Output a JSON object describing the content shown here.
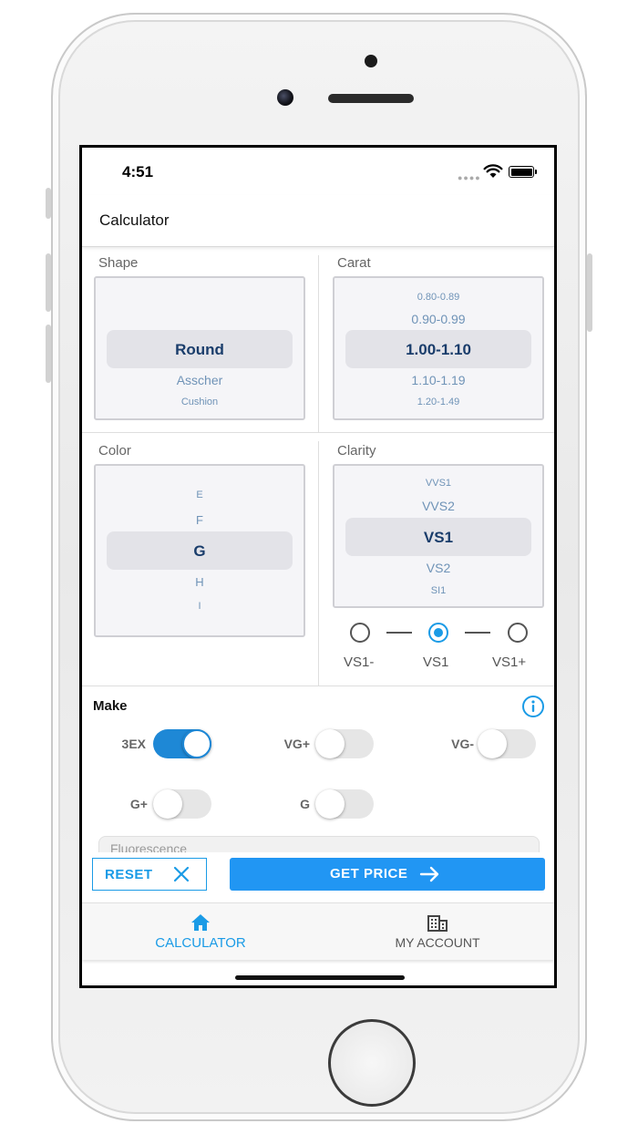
{
  "status_bar": {
    "time": "4:51"
  },
  "header": {
    "title": "Calculator"
  },
  "shape": {
    "label": "Shape",
    "options": [
      "Round",
      "Asscher",
      "Cushion"
    ],
    "selected": "Round"
  },
  "carat": {
    "label": "Carat",
    "options": [
      "0.80-0.89",
      "0.90-0.99",
      "1.00-1.10",
      "1.10-1.19",
      "1.20-1.49"
    ],
    "selected": "1.00-1.10"
  },
  "color": {
    "label": "Color",
    "options": [
      "E",
      "F",
      "G",
      "H",
      "I"
    ],
    "selected": "G"
  },
  "clarity": {
    "label": "Clarity",
    "options": [
      "VVS1",
      "VVS2",
      "VS1",
      "VS2",
      "SI1"
    ],
    "selected": "VS1",
    "grades": [
      {
        "label": "VS1-",
        "selected": false
      },
      {
        "label": "VS1",
        "selected": true
      },
      {
        "label": "VS1+",
        "selected": false
      }
    ]
  },
  "make": {
    "label": "Make",
    "options": [
      {
        "label": "3EX",
        "on": true
      },
      {
        "label": "VG+",
        "on": false
      },
      {
        "label": "VG-",
        "on": false
      },
      {
        "label": "G+",
        "on": false
      },
      {
        "label": "G",
        "on": false
      }
    ]
  },
  "fluorescence": {
    "label": "Fluorescence"
  },
  "actions": {
    "reset": "RESET",
    "get_price": "GET PRICE"
  },
  "tabs": [
    {
      "label": "CALCULATOR",
      "icon": "home-icon",
      "active": true
    },
    {
      "label": "MY ACCOUNT",
      "icon": "building-icon",
      "active": false
    }
  ],
  "colors": {
    "accent": "#2196f3",
    "toggle_on": "#1e88d6",
    "selected_text": "#1a3d6b"
  }
}
